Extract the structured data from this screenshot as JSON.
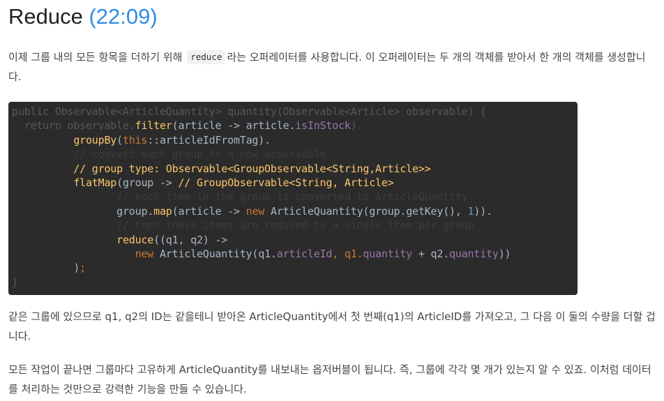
{
  "heading": {
    "title": "Reduce",
    "timestamp": "(22:09)"
  },
  "paragraphs": {
    "p1_before": "이제 그룹 내의 모든 항목을 더하기 위해",
    "p1_code": "reduce",
    "p1_after": "라는 오퍼레이터를 사용합니다. 이 오퍼레이터는 두 개의 객체를 받아서 한 개의 객체를 생성합니다.",
    "p2": "같은 그룹에 있으므로 q1, q2의 ID는 같을테니 받아온 ArticleQuantity에서 첫 번째(q1)의 ArticleID를 가져오고, 그 다음 이 둘의 수량을 더할 겁니다.",
    "p3": "모든 작업이 끝나면 그룹마다 고유하게 ArticleQuantity를 내보내는 옵저버블이 됩니다. 즉, 그룹에 각각 몇 개가 있는지 알 수 있죠. 이처럼 데이터를 처리하는 것만으로 강력한 기능을 만들 수 있습니다."
  },
  "code": {
    "l1": "public Observable<ArticleQuantity> quantity(Observable<Article> observable) {",
    "l2_a": "  return observable.",
    "l2_f": "filter",
    "l2_b": "(article -> article.",
    "l2_m": "isInStock",
    "l2_c": ").",
    "l3_ind": "          ",
    "l3_f": "groupBy",
    "l3_a": "(",
    "l3_k": "this",
    "l3_b": "::articleIdFromTag).",
    "l4": "          // convert each group to a new observable",
    "l5": "          // group type: Observable<GroupObservable<String,Article>>",
    "l6_ind": "          ",
    "l6_f": "flatMap",
    "l6_a": "(group -> ",
    "l6_c": "// GroupObservable<String, Article>",
    "l7": "                 // each item in the group is converted to ArticleQuantity",
    "l8_ind": "                 ",
    "l8_a": "group.",
    "l8_f": "map",
    "l8_b": "(article -> ",
    "l8_k": "new",
    "l8_c": " ArticleQuantity(group.getKey(), ",
    "l8_n": "1",
    "l8_d": ")).",
    "l9": "                 // then these items are reduced to a single item per group",
    "l10_ind": "                 ",
    "l10_f": "reduce",
    "l10_a": "((q1, q2) ->",
    "l11_ind": "                    ",
    "l11_k": "new",
    "l11_a": " ArticleQuantity(q1.",
    "l11_f1": "articleId",
    "l11_b": ", q1.",
    "l11_f2": "quantity",
    "l11_c": " + q2.",
    "l11_f3": "quantity",
    "l11_d": "))",
    "l12_ind": "          ",
    "l12_a": ")",
    "l12_b": ";",
    "l13": "}"
  }
}
